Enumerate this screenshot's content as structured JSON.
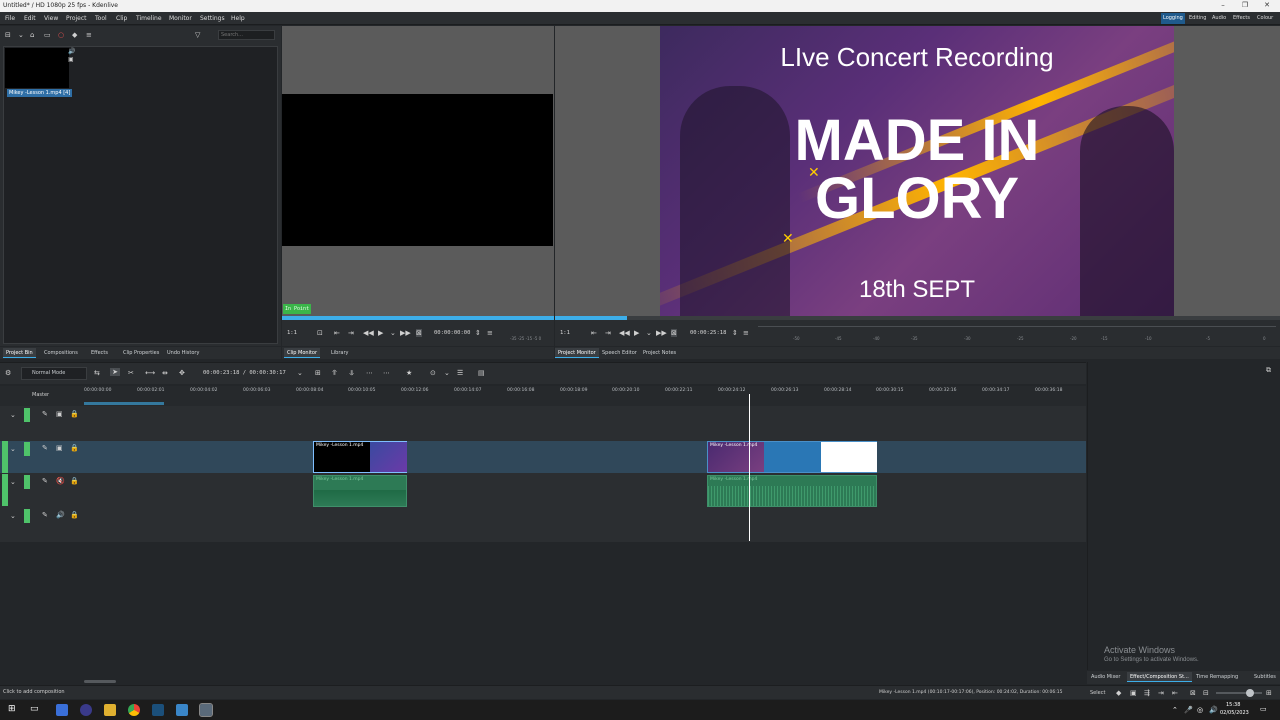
{
  "window": {
    "title": "Untitled* / HD 1080p 25 fps - Kdenlive",
    "min": "–",
    "max": "❐",
    "close": "✕"
  },
  "menu": {
    "items": [
      "File",
      "Edit",
      "View",
      "Project",
      "Tool",
      "Clip",
      "Timeline",
      "Monitor",
      "Settings",
      "Help"
    ]
  },
  "layouts": {
    "items": [
      "Logging",
      "Editing",
      "Audio",
      "Effects",
      "Colour"
    ],
    "active": "Logging"
  },
  "bin": {
    "search_placeholder": "Search...",
    "clip_name": "Mikey -Lesson 1.mp4 [4]",
    "tabs": [
      "Project Bin",
      "Compositions",
      "Effects",
      "Clip Properties",
      "Undo History"
    ]
  },
  "clip_monitor": {
    "badge": "In Point",
    "zoom": "1:1",
    "timecode": "00:00:00:00",
    "meter": "-35 -25 -15 -5 0",
    "tabs": [
      "Clip Monitor",
      "Library"
    ]
  },
  "project_monitor": {
    "overlay_title": "LIve Concert Recording",
    "overlay_main_1": "MADE IN",
    "overlay_main_2": "GLORY",
    "overlay_date": "18th SEPT",
    "zoom": "1:1",
    "timecode": "00:00:25:18",
    "meter_labels": [
      "-50",
      "-45",
      "-40",
      "-35",
      "-30",
      "-25",
      "-20",
      "-15",
      "-10",
      "-5",
      "0"
    ],
    "tabs": [
      "Project Monitor",
      "Speech Editor",
      "Project Notes"
    ]
  },
  "timeline": {
    "mode": "Normal Mode",
    "position": "00:00:23:18 / 00:00:30:17",
    "ruler": [
      "00:00:00:00",
      "00:00:02:01",
      "00:00:04:02",
      "00:00:06:03",
      "00:00:08:04",
      "00:00:10:05",
      "00:00:12:06",
      "00:00:14:07",
      "00:00:16:08",
      "00:00:18:09",
      "00:00:20:10",
      "00:00:22:11",
      "00:00:24:12",
      "00:00:26:13",
      "00:00:28:14",
      "00:00:30:15",
      "00:00:32:16",
      "00:00:34:17",
      "00:00:36:18"
    ],
    "master": "Master",
    "clip1_label": "Mikey -Lesson 1.mp4",
    "clip2_label": "Mikey -Lesson 1.mp4",
    "audio1_label": "Mikey -Lesson 1.mp4",
    "audio2_label": "Mikey -Lesson 1.mp4"
  },
  "status": {
    "left": "Click to add composition",
    "info": "Mikey -Lesson 1.mp4 (00:10:17-00:17:06), Position: 00:24:02, Duration: 00:06:15",
    "select": "Select"
  },
  "bottom_tabs": [
    "Audio Mixer",
    "Effect/Composition St...",
    "Time Remapping",
    "Subtitles"
  ],
  "watermark": {
    "line1": "Activate Windows",
    "line2": "Go to Settings to activate Windows."
  },
  "taskbar": {
    "time": "15:38",
    "date": "02/05/2023"
  },
  "colors": {
    "accent": "#3daee9",
    "track_green": "#4fc36a",
    "video_clip": "#2a77b5",
    "audio_clip": "#2d7a55"
  }
}
